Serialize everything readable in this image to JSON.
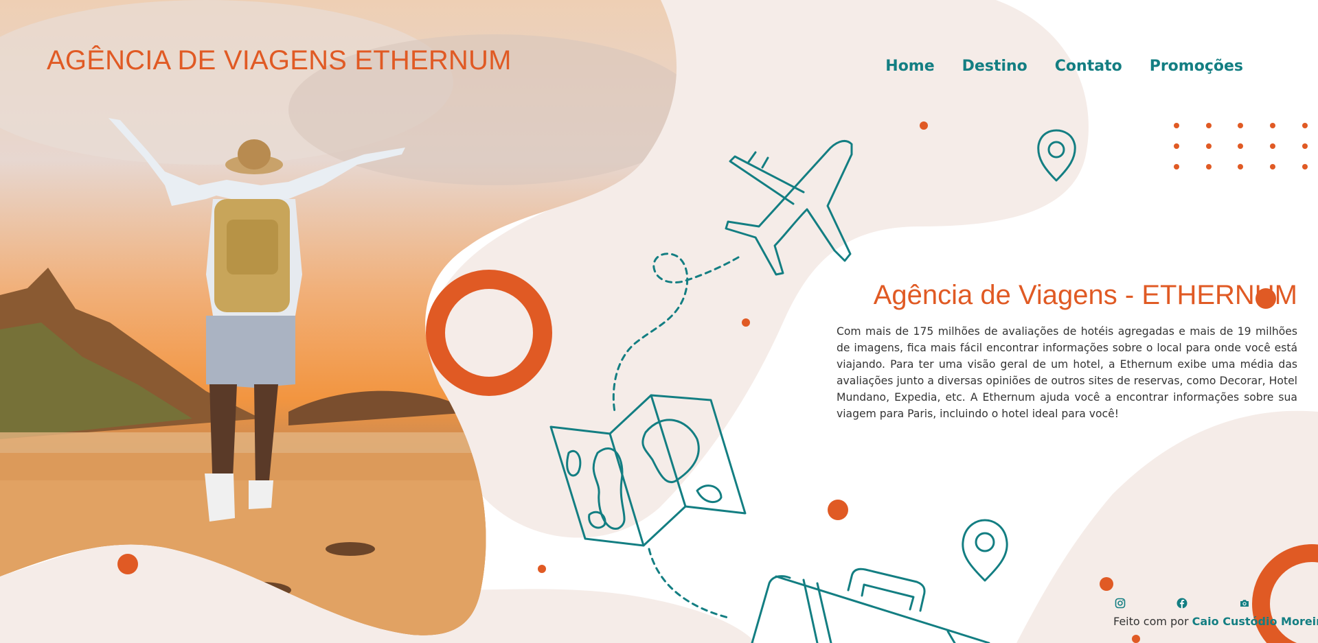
{
  "site": {
    "logo_text": "AGÊNCIA DE VIAGENS ETHERNUM"
  },
  "nav": {
    "items": [
      {
        "label": "Home",
        "name": "nav-home"
      },
      {
        "label": "Destino",
        "name": "nav-destino"
      },
      {
        "label": "Contato",
        "name": "nav-contato"
      },
      {
        "label": "Promoções",
        "name": "nav-promocoes"
      }
    ]
  },
  "main": {
    "title": "Agência de Viagens - ETHERNUM",
    "description": "Com mais de 175 milhões de avaliações de hotéis agregadas e mais de 19 milhões de imagens, fica mais fácil encontrar informações sobre o local para onde você está viajando. Para ter uma visão geral de um hotel, a Ethernum exibe uma média das avaliações junto a diversas opiniões de outros sites de reservas, como Decorar, Hotel Mundano, Expedia, etc. A Ethernum ajuda você a encontrar informações sobre sua viagem para Paris, incluindo o hotel ideal para você!"
  },
  "footer": {
    "social": [
      "instagram-icon",
      "facebook-icon",
      "camera-icon"
    ],
    "credit_prefix": "Feito com por",
    "credit_author": "Caio Custódio Moreira"
  },
  "colors": {
    "accent_orange": "#e05a24",
    "teal": "#137e82",
    "blob_beige": "#f5ece8",
    "text": "#333333"
  },
  "icons": [
    "airplane-icon",
    "map-icon",
    "location-pin-icon",
    "suitcase-icon",
    "dotted-flight-path"
  ]
}
